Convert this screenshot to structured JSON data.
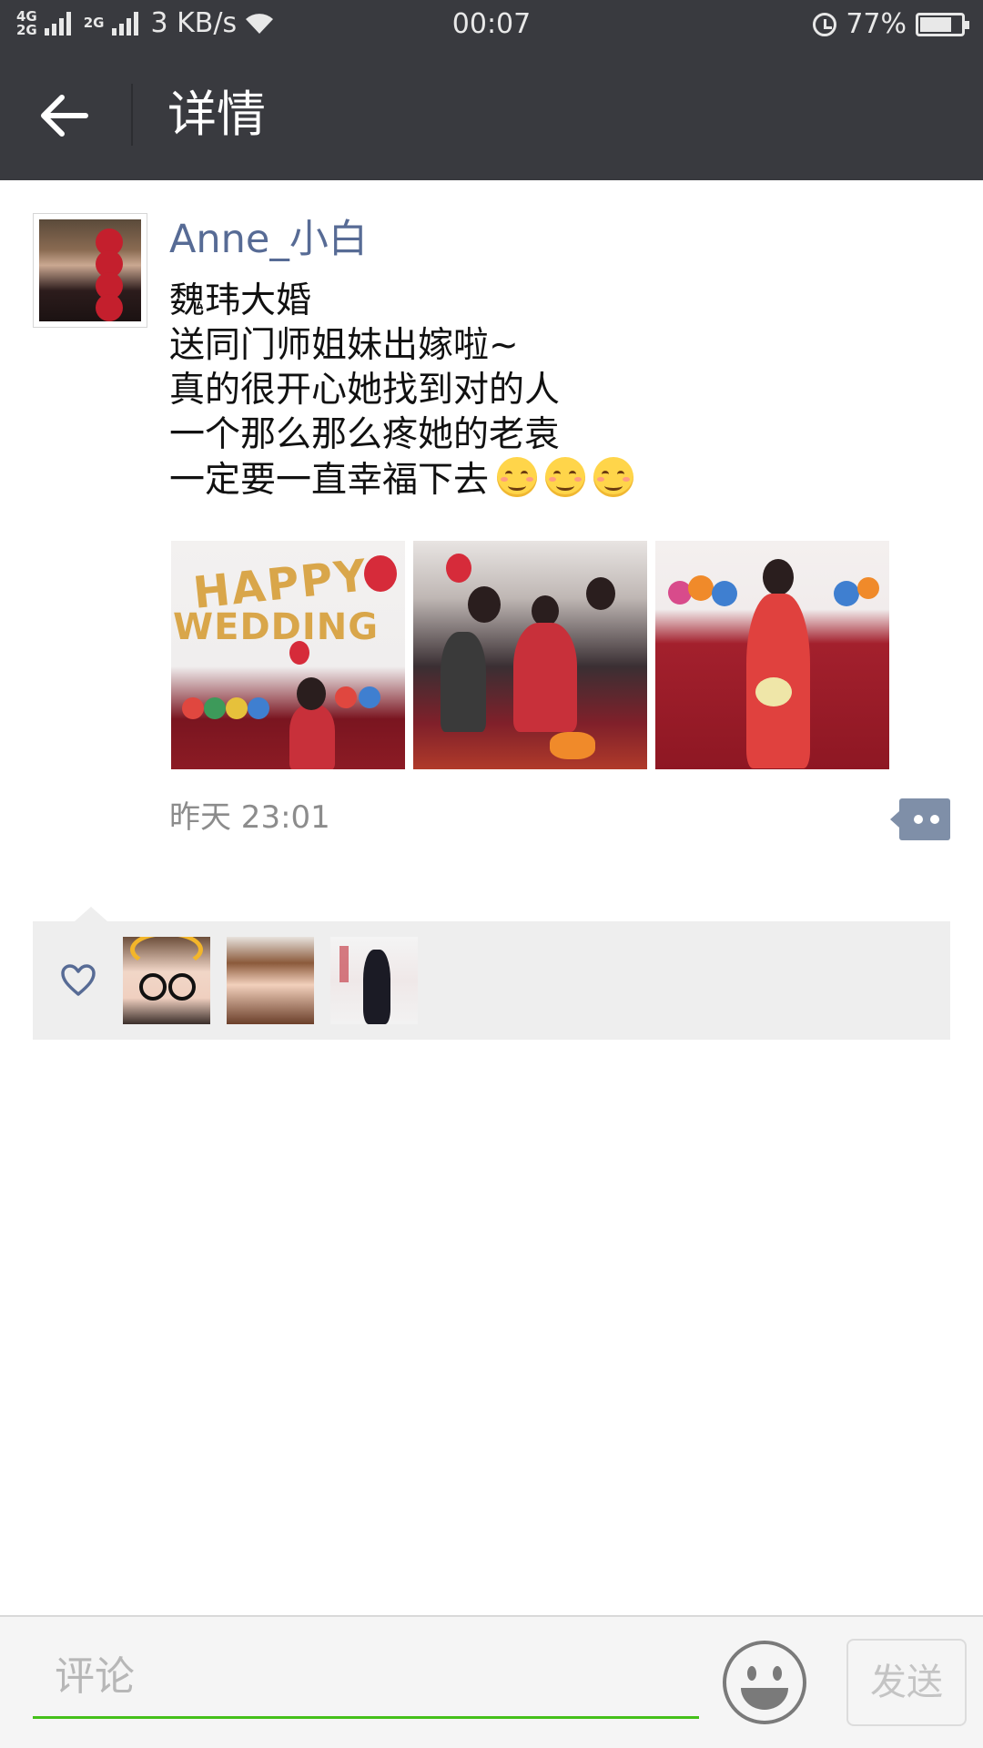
{
  "status_bar": {
    "network_tag_top": "4G",
    "network_tag_bottom": "2G",
    "network_tag_2": "2G",
    "speed": "3 KB/s",
    "time": "00:07",
    "battery_percent": "77%",
    "battery_level": 0.77,
    "icons": [
      "signal-icon",
      "wifi-icon",
      "alarm-icon",
      "battery-icon"
    ]
  },
  "header": {
    "back_icon": "arrow-left-icon",
    "title": "详情",
    "bg_color": "#393a3f"
  },
  "post": {
    "user_name": "Anne_小白",
    "lines": [
      "魏玮大婚",
      "送同门师姐妹出嫁啦~",
      "真的很开心她找到对的人",
      "一个那么那么疼她的老袁",
      "一定要一直幸福下去"
    ],
    "trailing_emoji_count": 3,
    "photos": [
      {
        "overlay_text": "HAPPY"
      },
      {
        "overlay_text": "WEDDING"
      }
    ],
    "time": "昨天 23:01",
    "name_color": "#576b95"
  },
  "likes": {
    "icon": "heart-outline-icon",
    "avatars": [
      "liker-avatar-1",
      "liker-avatar-2",
      "liker-avatar-3"
    ]
  },
  "comment_bar": {
    "placeholder": "评论",
    "value": "",
    "emoji_icon": "smiley-face-icon",
    "send_label": "发送",
    "accent_color": "#45c01a"
  }
}
